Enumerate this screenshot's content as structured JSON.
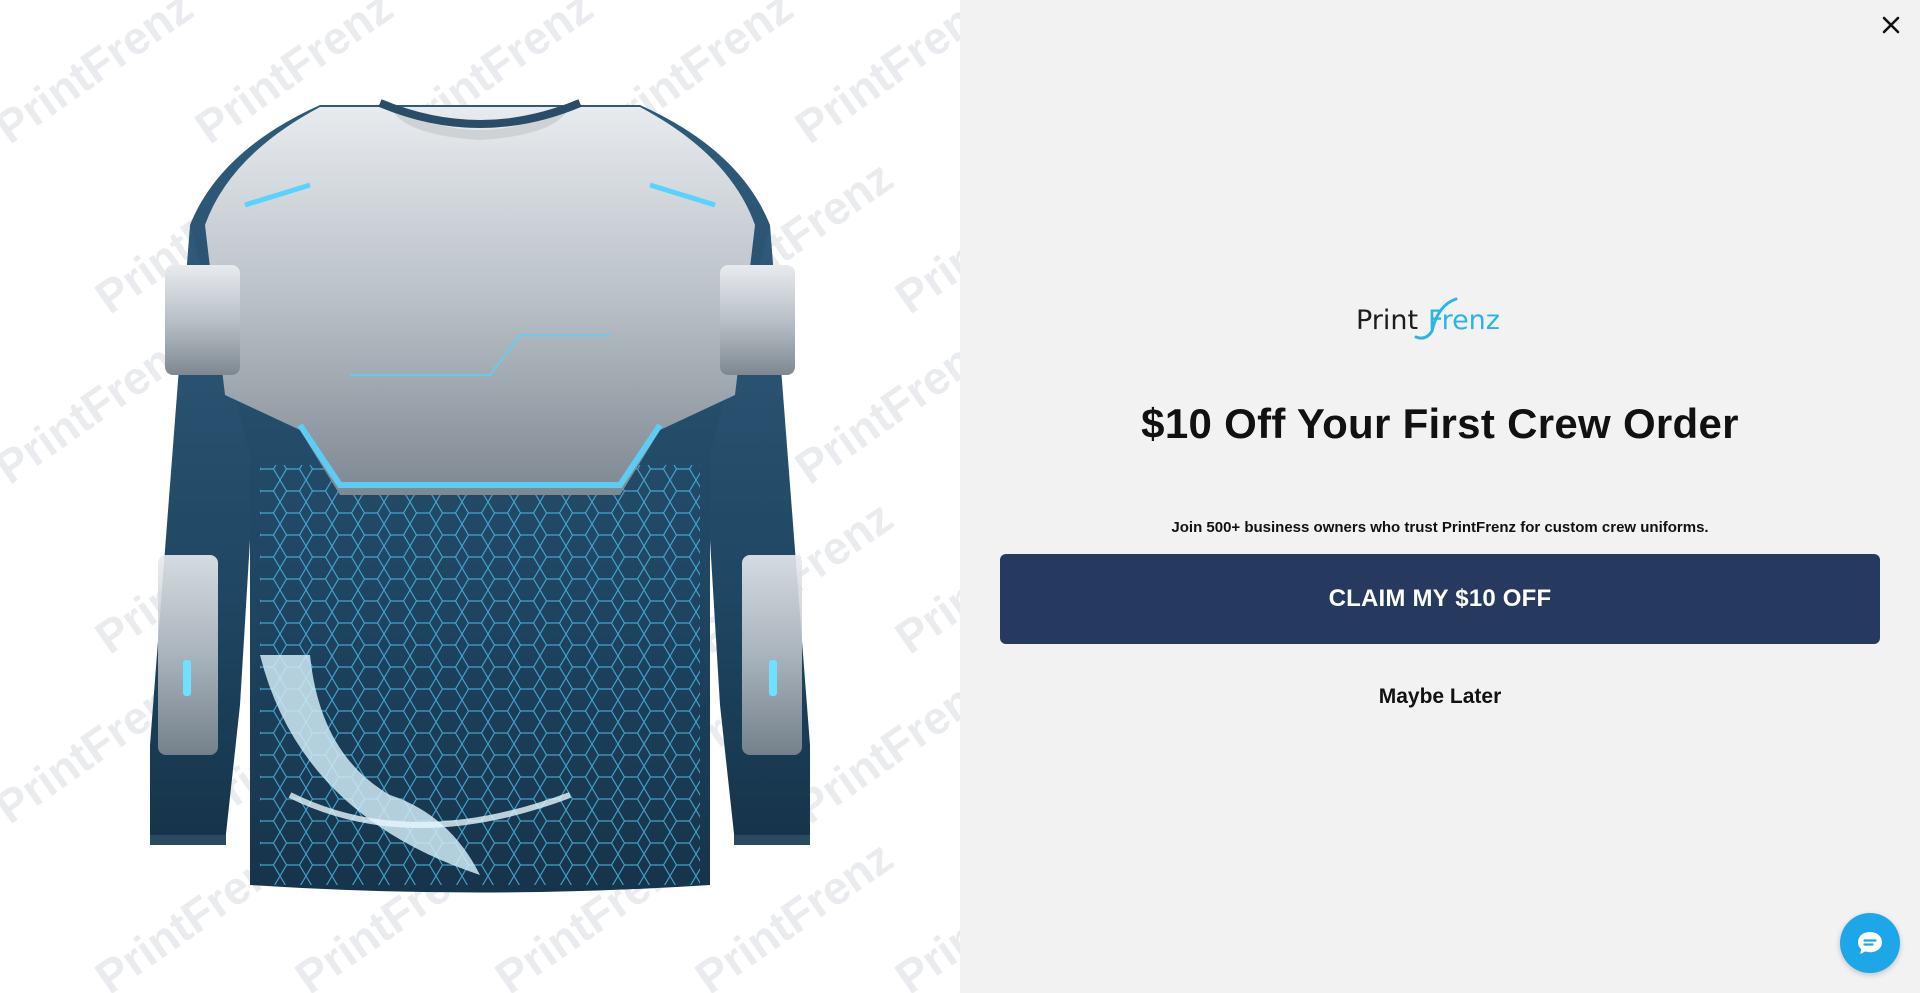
{
  "product_image": {
    "alt": "Long sleeve crew shirt with futuristic armor and water print",
    "watermark_text": "PrintFrenz"
  },
  "modal": {
    "close_icon": "close-icon",
    "logo": {
      "part1": "Print",
      "part2": "Frenz",
      "colors": {
        "dark": "#1d1d1f",
        "accent": "#2bb5e6"
      }
    },
    "headline": "$10 Off Your First Crew Order",
    "subtext": "Join 500+ business owners who trust PrintFrenz for custom crew uniforms.",
    "cta_label": "CLAIM MY $10 OFF",
    "dismiss_label": "Maybe Later"
  },
  "chat_widget": {
    "icon": "chat-icon",
    "color": "#1ea7e8"
  },
  "colors": {
    "cta_bg": "#253a5e",
    "panel_bg": "#f2f2f2"
  }
}
